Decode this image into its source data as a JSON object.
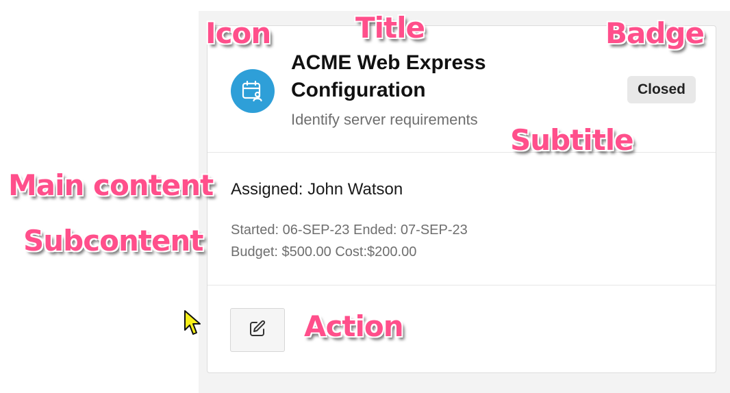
{
  "card": {
    "icon": "calendar-user-icon",
    "title": "ACME Web Express Configuration",
    "subtitle": "Identify server requirements",
    "badge": "Closed",
    "main_content": "Assigned: John Watson",
    "subcontent": [
      "Started: 06-SEP-23 Ended: 07-SEP-23",
      "Budget: $500.00 Cost:$200.00"
    ],
    "action_icon": "edit-icon"
  },
  "annotations": {
    "icon": "Icon",
    "title": "Title",
    "badge": "Badge",
    "subtitle": "Subtitle",
    "main_content": "Main content",
    "subcontent": "Subcontent",
    "action": "Action"
  },
  "colors": {
    "icon_background": "#2e9fd8",
    "annotation": "#ff4f8b",
    "badge_background": "#e8e8e8"
  }
}
